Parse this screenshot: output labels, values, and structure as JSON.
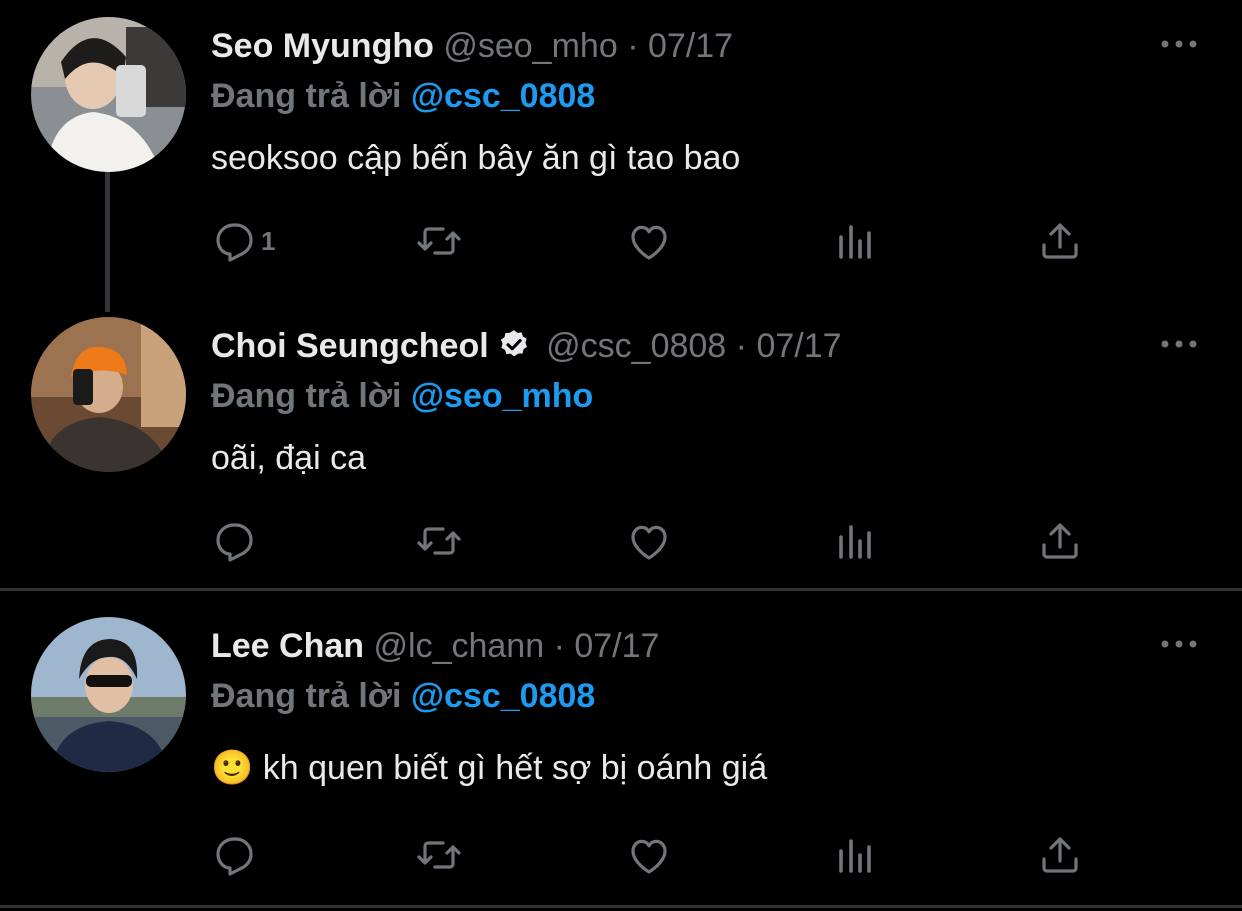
{
  "tweets": [
    {
      "display_name": "Seo Myungho",
      "handle": "@seo_mho",
      "date": "07/17",
      "reply_prefix": "Đang trả lời",
      "reply_to": "@csc_0808",
      "text": "seoksoo cập bến bây ăn gì tao bao",
      "reply_count": "1",
      "verified": false
    },
    {
      "display_name": "Choi Seungcheol",
      "handle": "@csc_0808",
      "date": "07/17",
      "reply_prefix": "Đang trả lời",
      "reply_to": "@seo_mho",
      "text": "oãi, đại ca",
      "reply_count": "",
      "verified": true
    },
    {
      "display_name": "Lee Chan",
      "handle": "@lc_chann",
      "date": "07/17",
      "reply_prefix": "Đang trả lời",
      "reply_to": "@csc_0808",
      "text": "kh quen biết gì hết sợ bị oánh giá",
      "emoji": "🙂",
      "reply_count": "",
      "verified": false
    }
  ],
  "separator": "·",
  "colors": {
    "background": "#000000",
    "text": "#e7e9ea",
    "secondary": "#71767b",
    "accent": "#1d9bf0",
    "divider": "#2f3336"
  },
  "icons": [
    "reply-icon",
    "retweet-icon",
    "like-icon",
    "views-icon",
    "share-icon",
    "more-icon",
    "verified-badge-icon"
  ]
}
